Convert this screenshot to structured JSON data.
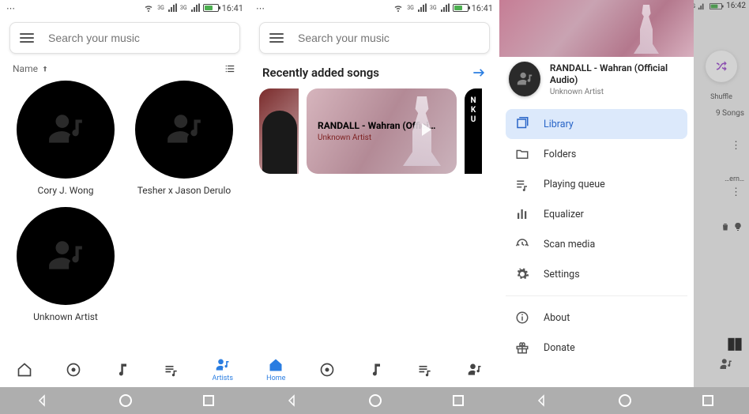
{
  "status": {
    "time1": "16:41",
    "time2": "16:41",
    "time3": "16:42",
    "net_label": "3G"
  },
  "search": {
    "placeholder": "Search your music"
  },
  "panel1": {
    "sort_label": "Name",
    "artists": [
      {
        "name": "Cory J. Wong"
      },
      {
        "name": "Tesher x Jason Derulo"
      },
      {
        "name": "Unknown Artist"
      }
    ],
    "active_tab": "Artists"
  },
  "panel2": {
    "section_title": "Recently added songs",
    "card_title": "RANDALL - Wahran (Offici…",
    "card_sub": "Unknown Artist",
    "card3_l1": "N",
    "card3_l2": "K",
    "card3_l3": "U",
    "active_tab": "Home"
  },
  "panel3": {
    "now_playing_title": "RANDALL - Wahran (Official Audio)",
    "now_playing_artist": "Unknown Artist",
    "menu": {
      "library": "Library",
      "folders": "Folders",
      "queue": "Playing queue",
      "equalizer": "Equalizer",
      "scan": "Scan media",
      "settings": "Settings",
      "about": "About",
      "donate": "Donate"
    },
    "behind": {
      "shuffle": "Shuffle",
      "count": "9 Songs",
      "truncated": "…ern…"
    }
  },
  "tabs": {
    "home": "Home",
    "artists": "Artists"
  }
}
